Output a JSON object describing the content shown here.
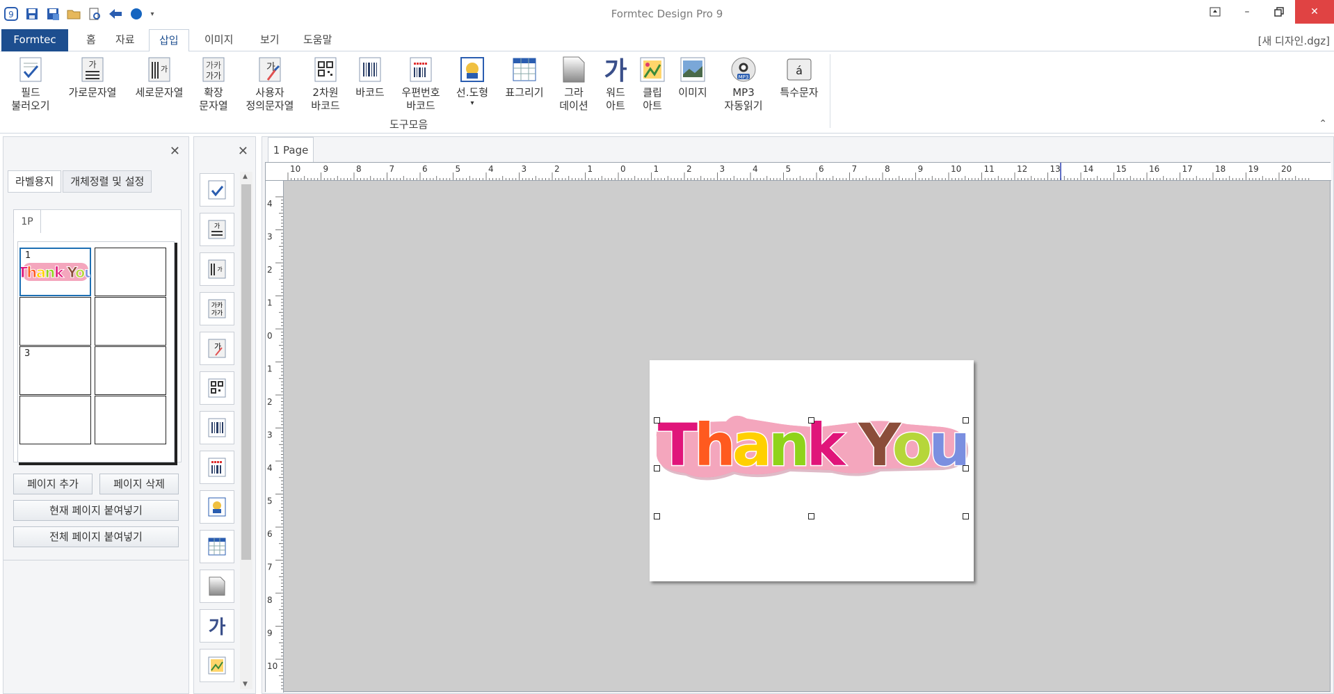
{
  "app": {
    "title": "Formtec Design Pro 9"
  },
  "tabs": [
    "Formtec",
    "홈",
    "자료",
    "삽입",
    "이미지",
    "보기",
    "도움말"
  ],
  "active_tab": "삽입",
  "document": {
    "name": "[새 디자인.dgz]"
  },
  "ribbon": {
    "buttons": [
      {
        "line1": "필드",
        "line2": "불러오기"
      },
      {
        "line1": "가로문자열",
        "line2": ""
      },
      {
        "line1": "세로문자열",
        "line2": ""
      },
      {
        "line1": "확장",
        "line2": "문자열"
      },
      {
        "line1": "사용자",
        "line2": "정의문자열"
      },
      {
        "line1": "2차원",
        "line2": "바코드"
      },
      {
        "line1": "바코드",
        "line2": ""
      },
      {
        "line1": "우편번호",
        "line2": "바코드"
      },
      {
        "line1": "선.도형",
        "line2": "▾"
      },
      {
        "line1": "표그리기",
        "line2": ""
      },
      {
        "line1": "그라",
        "line2": "데이션"
      },
      {
        "line1": "워드",
        "line2": "아트"
      },
      {
        "line1": "클립",
        "line2": "아트"
      },
      {
        "line1": "이미지",
        "line2": ""
      },
      {
        "line1": "MP3",
        "line2": "자동읽기"
      },
      {
        "line1": "특수문자",
        "line2": ""
      }
    ],
    "group_label": "도구모음"
  },
  "left_panel": {
    "tabs": [
      "라벨용지",
      "개체정렬 및 설정"
    ],
    "page_tab": "1P",
    "cell_numbers": [
      "1",
      "3"
    ],
    "buttons": {
      "add_page": "페이지 추가",
      "delete_page": "페이지 삭제",
      "paste_current": "현재 페이지 붙여넣기",
      "paste_all": "전체 페이지 붙여넣기"
    }
  },
  "workspace": {
    "page_tab": "1 Page",
    "h_ruler": [
      "10",
      "9",
      "8",
      "7",
      "6",
      "5",
      "4",
      "3",
      "2",
      "1",
      "0",
      "1",
      "2",
      "3",
      "4",
      "5",
      "6",
      "7",
      "8",
      "9",
      "10",
      "11",
      "12",
      "13",
      "14",
      "15",
      "16",
      "17",
      "18",
      "19",
      "20"
    ],
    "v_ruler": [
      "4",
      "3",
      "2",
      "1",
      "0",
      "1",
      "2",
      "3",
      "4",
      "5",
      "6",
      "7",
      "8",
      "9",
      "10"
    ]
  },
  "label_art": {
    "text": "Thank You"
  },
  "colors": {
    "brand": "#1d4e8f",
    "art_bg": "#f4a6bd",
    "close": "#e04343"
  }
}
